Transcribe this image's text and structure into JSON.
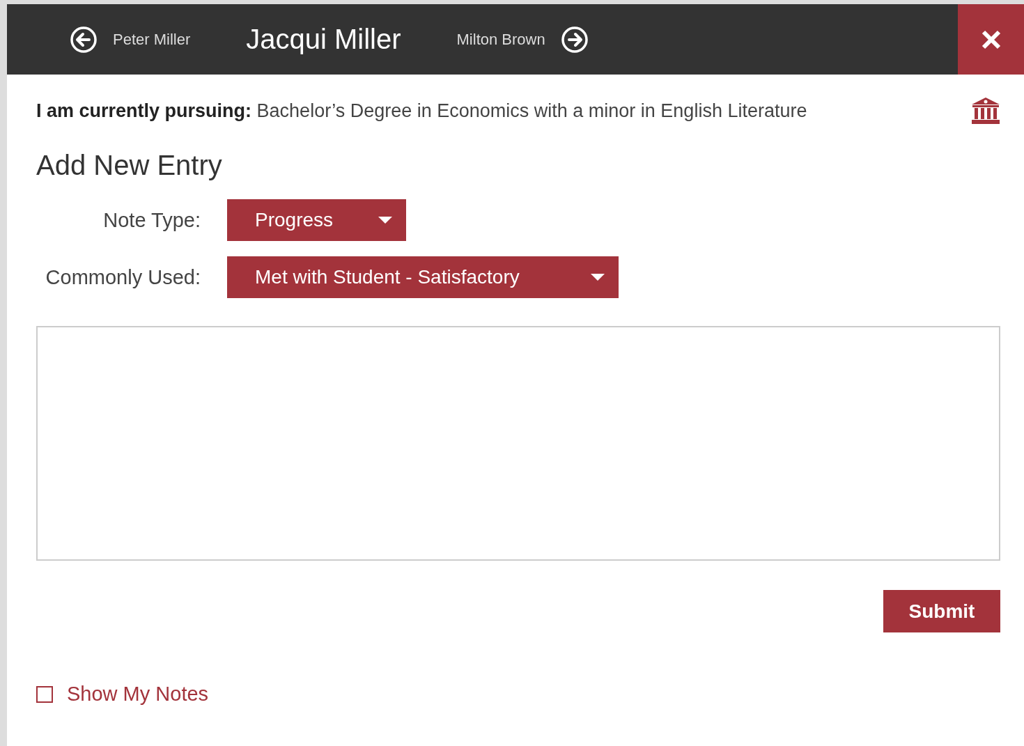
{
  "header": {
    "previous": "Peter Miller",
    "current": "Jacqui Miller",
    "next": "Milton Brown"
  },
  "pursuing": {
    "label": "I am currently pursuing:",
    "value": "Bachelor’s Degree in Economics with a minor in English Literature"
  },
  "heading": "Add New Entry",
  "fields": [
    {
      "label": "Note Type:",
      "value": "Progress",
      "kind": "short"
    },
    {
      "label": "Commonly Used:",
      "value": "Met with Student - Satisfactory",
      "kind": "wide"
    }
  ],
  "submit": "Submit",
  "show_notes": {
    "label": "Show My Notes",
    "checked": false
  }
}
